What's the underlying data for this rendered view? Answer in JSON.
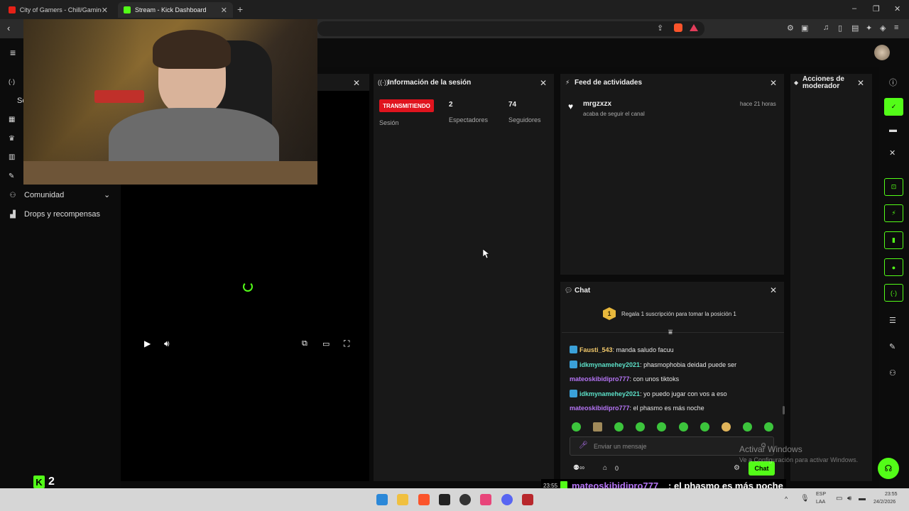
{
  "browser": {
    "tabs": [
      {
        "title": "City of Gamers - Chill/Gaming/St"
      },
      {
        "title": "Stream - Kick Dashboard"
      }
    ],
    "new_tab": "+",
    "win_minimize": "–",
    "win_restore": "❐",
    "win_close": "✕"
  },
  "sidebar": {
    "items": [
      {
        "label": "Comunidad",
        "icon": "community-icon"
      },
      {
        "label": "Drops y recompensas",
        "icon": "drops-icon"
      }
    ],
    "partial_label": "Se"
  },
  "player_panel": {
    "close": "✕"
  },
  "session": {
    "title": "Información de la sesión",
    "status": "TRANSMITIENDO",
    "status_label": "Sesión",
    "viewers": "2",
    "viewers_label": "Espectadores",
    "followers": "74",
    "followers_label": "Seguidores",
    "colors": {
      "status_bg": "#e0141e"
    }
  },
  "activity": {
    "title": "Feed de actividades",
    "entries": [
      {
        "user": "mrgzxzx",
        "text": "acaba de seguir el canal",
        "time": "hace 21 horas"
      }
    ]
  },
  "mod": {
    "title_line1": "Acciones de",
    "title_line2": "moderador"
  },
  "chat": {
    "title": "Chat",
    "gift_text": "Regala 1 suscripción para tomar la posición 1",
    "gift_rank": "1",
    "messages": [
      {
        "user": "Fausti_543",
        "text": ": manda saludo facuu",
        "color": "#f1c86b",
        "badge": true
      },
      {
        "user": "idkmynamehey2021",
        "text": ": phasmophobia deidad puede ser",
        "color": "#5ce0c8",
        "badge": true
      },
      {
        "user": "mateoskibidipro777",
        "text": ": con unos tiktoks",
        "color": "#b574f5",
        "badge": false
      },
      {
        "user": "idkmynamehey2021",
        "text": ": yo puedo jugar con vos a eso",
        "color": "#5ce0c8",
        "badge": true
      },
      {
        "user": "mateoskibidipro777",
        "text": ": el phasmo es más noche",
        "color": "#b574f5",
        "badge": false
      }
    ],
    "input_placeholder": "Enviar un mensaje",
    "users_count": "0",
    "send_label": "Chat"
  },
  "overlay": {
    "time": "23:55",
    "user": "mateoskibidipro777",
    "text": " : el phasmo es más noche",
    "kick_count": "2"
  },
  "windows": {
    "activate_title": "Activar Windows",
    "activate_sub": "Ve a Configuración para activar Windows.",
    "lang": "ESP",
    "lang2": "LAA",
    "clock_time": "23:55",
    "clock_date": "24/2/2026"
  },
  "colors": {
    "accent": "#53fc18",
    "panel": "#181818",
    "bg": "#0b0b0b"
  }
}
